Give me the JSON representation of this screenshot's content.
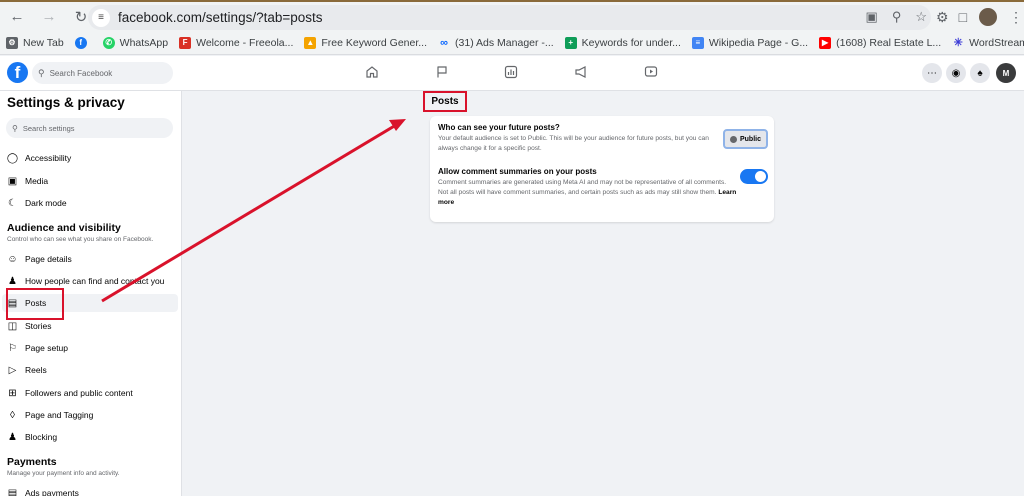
{
  "browser": {
    "url": "facebook.com/settings/?tab=posts",
    "bookmarks": [
      {
        "label": "New Tab",
        "color": "#5f6368",
        "glyph": "⚙"
      },
      {
        "label": "",
        "color": "#1877f2",
        "glyph": "f"
      },
      {
        "label": "WhatsApp",
        "color": "#25d366",
        "glyph": "✆"
      },
      {
        "label": "Welcome - Freeola...",
        "color": "#d93025",
        "glyph": "F"
      },
      {
        "label": "Free Keyword Gener...",
        "color": "#f4a300",
        "glyph": "▲"
      },
      {
        "label": "(31) Ads Manager -...",
        "color": "#0866ff",
        "glyph": "∞"
      },
      {
        "label": "Keywords for under...",
        "color": "#0f9d58",
        "glyph": "+"
      },
      {
        "label": "Wikipedia Page - G...",
        "color": "#4285f4",
        "glyph": "≡"
      },
      {
        "label": "(1608) Real Estate L...",
        "color": "#ff0000",
        "glyph": "▶"
      },
      {
        "label": "WordStream | Free...",
        "color": "#3b3bd6",
        "glyph": "✳"
      }
    ]
  },
  "fb": {
    "search_placeholder": "Search Facebook",
    "avatar_initials": "M"
  },
  "sidebar": {
    "title": "Settings & privacy",
    "search_placeholder": "Search settings",
    "items_top": [
      {
        "label": "Accessibility",
        "icon": "accessibility-icon"
      },
      {
        "label": "Media",
        "icon": "media-icon"
      },
      {
        "label": "Dark mode",
        "icon": "moon-icon"
      }
    ],
    "section_audience": {
      "title": "Audience and visibility",
      "subtitle": "Control who can see what you share on Facebook."
    },
    "items_audience": [
      {
        "label": "Page details",
        "icon": "page-details-icon"
      },
      {
        "label": "How people can find and contact you",
        "icon": "people-icon"
      },
      {
        "label": "Posts",
        "icon": "posts-icon"
      },
      {
        "label": "Stories",
        "icon": "stories-icon"
      },
      {
        "label": "Page setup",
        "icon": "flag-icon"
      },
      {
        "label": "Reels",
        "icon": "reels-icon"
      },
      {
        "label": "Followers and public content",
        "icon": "followers-icon"
      },
      {
        "label": "Page and Tagging",
        "icon": "tag-icon"
      },
      {
        "label": "Blocking",
        "icon": "blocking-icon"
      }
    ],
    "section_payments": {
      "title": "Payments",
      "subtitle": "Manage your payment info and activity."
    },
    "items_payments": [
      {
        "label": "Ads payments",
        "icon": "ads-payments-icon"
      }
    ]
  },
  "main": {
    "heading": "Posts",
    "future_posts": {
      "label": "Who can see your future posts?",
      "desc": "Your default audience is set to Public. This will be your audience for future posts, but you can always change it for a specific post.",
      "button": "Public"
    },
    "comment_summaries": {
      "label": "Allow comment summaries on your posts",
      "desc": "Comment summaries are generated using Meta AI and may not be representative of all comments. Not all posts will have comment summaries, and certain posts such as ads may still show them.",
      "link": "Learn more",
      "enabled": true
    }
  },
  "colors": {
    "fb_blue": "#1877f2",
    "annotation_red": "#d9122b"
  }
}
